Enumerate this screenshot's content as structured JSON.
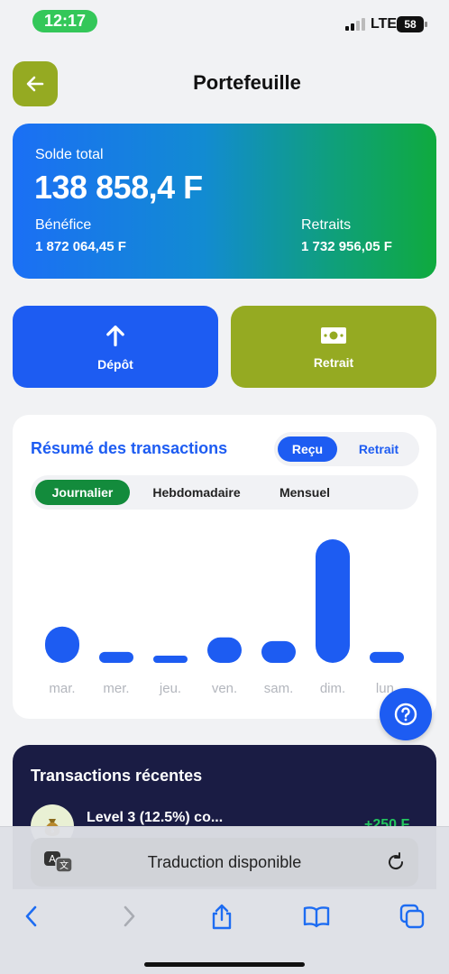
{
  "status": {
    "time": "12:17",
    "network": "LTE",
    "battery": "58"
  },
  "header": {
    "title": "Portefeuille"
  },
  "balance": {
    "total_label": "Solde total",
    "total_value": "138 858,4 F",
    "profit_label": "Bénéfice",
    "profit_value": "1 872 064,45 F",
    "withdrawals_label": "Retraits",
    "withdrawals_value": "1 732 956,05 F"
  },
  "actions": {
    "deposit_label": "Dépôt",
    "withdraw_label": "Retrait"
  },
  "summary": {
    "title": "Résumé des transactions",
    "type_toggle": [
      "Reçu",
      "Retrait"
    ],
    "period_toggle": [
      "Journalier",
      "Hebdomadaire",
      "Mensuel"
    ]
  },
  "chart_data": {
    "type": "bar",
    "categories": [
      "mar.",
      "mer.",
      "jeu.",
      "ven.",
      "sam.",
      "dim.",
      "lun."
    ],
    "values": [
      5,
      1.5,
      0.7,
      3.5,
      3,
      17,
      1.5
    ],
    "color": "#1d5cf2"
  },
  "recent": {
    "title": "Transactions récentes",
    "first_tx": {
      "name": "Level 3 (12.5%) co...",
      "amount": "+250 F"
    }
  },
  "browser": {
    "translate_text": "Traduction disponible"
  },
  "colors": {
    "primary": "#1d5cf2",
    "olive": "#95aa22",
    "green": "#138b3c",
    "navy": "#1a1c44"
  }
}
